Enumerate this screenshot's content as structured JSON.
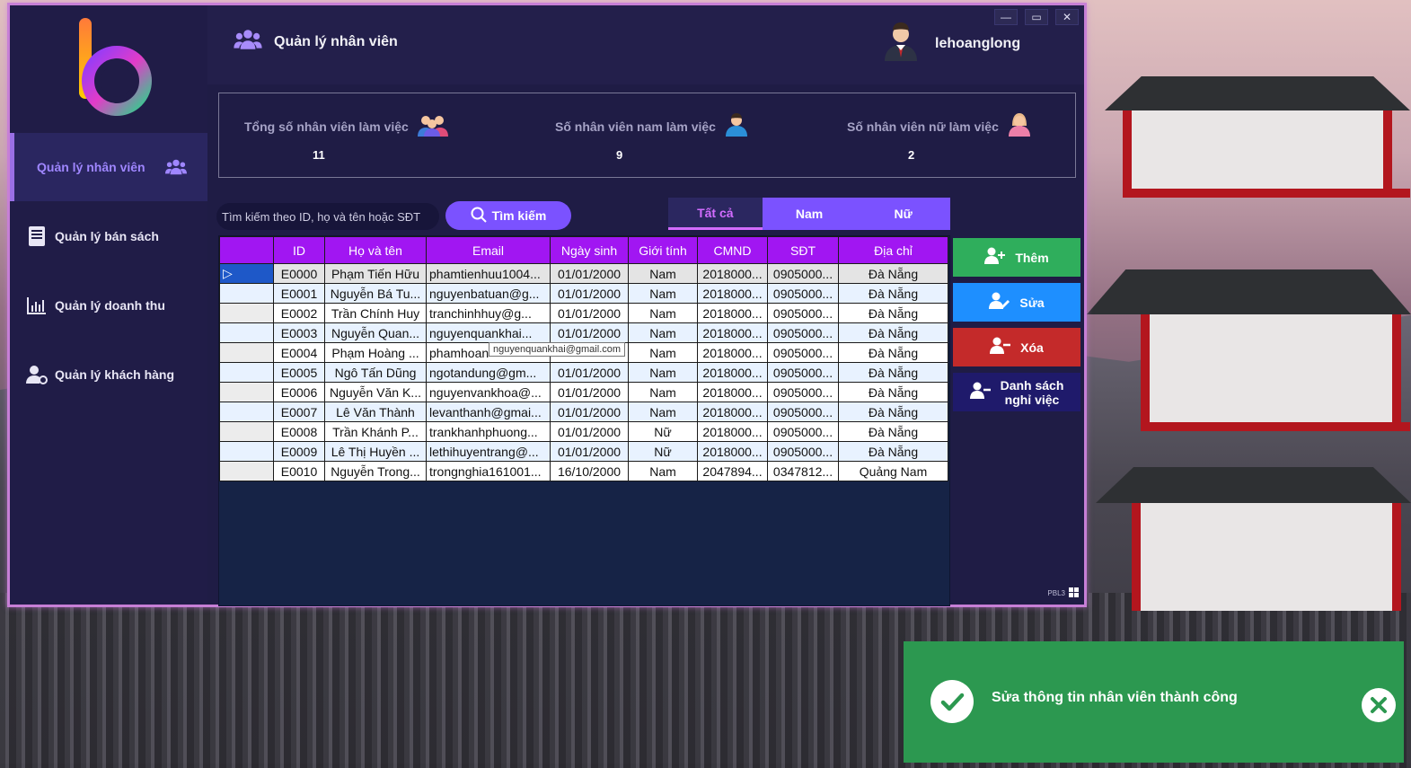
{
  "sidebar": {
    "items": [
      {
        "label": "Quản lý nhân viên",
        "icon": "users-icon"
      },
      {
        "label": "Quản lý bán sách",
        "icon": "book-icon"
      },
      {
        "label": "Quản lý doanh thu",
        "icon": "bar-chart-icon"
      },
      {
        "label": "Quản lý khách hàng",
        "icon": "user-gear-icon"
      }
    ]
  },
  "header": {
    "title": "Quản lý nhân viên",
    "username": "lehoanglong"
  },
  "window": {
    "minimize": "—",
    "maximize": "▭",
    "close": "✕"
  },
  "stats": {
    "total": {
      "label": "Tổng số nhân viên làm việc",
      "value": "11"
    },
    "male": {
      "label": "Số nhân viên nam làm việc",
      "value": "9"
    },
    "female": {
      "label": "Số nhân viên nữ làm việc",
      "value": "2"
    }
  },
  "search": {
    "placeholder": "Tìm kiếm theo ID, họ và tên hoặc SĐT",
    "button": "Tìm kiếm"
  },
  "filters": {
    "all": "Tất cả",
    "male": "Nam",
    "female": "Nữ"
  },
  "table": {
    "columns": [
      "",
      "ID",
      "Họ và tên",
      "Email",
      "Ngày sinh",
      "Giới tính",
      "CMND",
      "SĐT",
      "Địa chỉ"
    ],
    "rows": [
      [
        "E0000",
        "Phạm Tiến Hữu",
        "phamtienhuu1004...",
        "01/01/2000",
        "Nam",
        "2018000...",
        "0905000...",
        "Đà Nẵng"
      ],
      [
        "E0001",
        "Nguyễn Bá Tu...",
        "nguyenbatuan@g...",
        "01/01/2000",
        "Nam",
        "2018000...",
        "0905000...",
        "Đà Nẵng"
      ],
      [
        "E0002",
        "Trần Chính Huy",
        "tranchinhhuy@g...",
        "01/01/2000",
        "Nam",
        "2018000...",
        "0905000...",
        "Đà Nẵng"
      ],
      [
        "E0003",
        "Nguyễn Quan...",
        "nguyenquankhai...",
        "01/01/2000",
        "Nam",
        "2018000...",
        "0905000...",
        "Đà Nẵng"
      ],
      [
        "E0004",
        "Phạm Hoàng ...",
        "phamhoan",
        "",
        "Nam",
        "2018000...",
        "0905000...",
        "Đà Nẵng"
      ],
      [
        "E0005",
        "Ngô Tấn Dũng",
        "ngotandung@gm...",
        "01/01/2000",
        "Nam",
        "2018000...",
        "0905000...",
        "Đà Nẵng"
      ],
      [
        "E0006",
        "Nguyễn Văn K...",
        "nguyenvankhoa@...",
        "01/01/2000",
        "Nam",
        "2018000...",
        "0905000...",
        "Đà Nẵng"
      ],
      [
        "E0007",
        "Lê Văn Thành",
        "levanthanh@gmai...",
        "01/01/2000",
        "Nam",
        "2018000...",
        "0905000...",
        "Đà Nẵng"
      ],
      [
        "E0008",
        "Trần Khánh P...",
        "trankhanhphuong...",
        "01/01/2000",
        "Nữ",
        "2018000...",
        "0905000...",
        "Đà Nẵng"
      ],
      [
        "E0009",
        "Lê Thị Huyền ...",
        "lethihuyentrang@...",
        "01/01/2000",
        "Nữ",
        "2018000...",
        "0905000...",
        "Đà Nẵng"
      ],
      [
        "E0010",
        "Nguyễn Trong...",
        "trongnghia161001...",
        "16/10/2000",
        "Nam",
        "2047894...",
        "0347812...",
        "Quảng Nam"
      ]
    ],
    "tooltip": "nguyenquankhai@gmail.com",
    "selected_marker": "▷"
  },
  "actions": {
    "add": "Thêm",
    "edit": "Sửa",
    "delete": "Xóa",
    "resigned_line1": "Danh sách",
    "resigned_line2": "nghỉ việc"
  },
  "footer": {
    "tag": "PBL3"
  },
  "toast": {
    "message": "Sửa thông tin nhân viên thành công"
  },
  "colors": {
    "accent": "#7b52ff",
    "header_purple": "#a116f2",
    "add": "#2fae5c",
    "edit": "#1e8fff",
    "delete": "#c42a2a",
    "resigned": "#1f1a6b",
    "toast": "#2c9850"
  }
}
